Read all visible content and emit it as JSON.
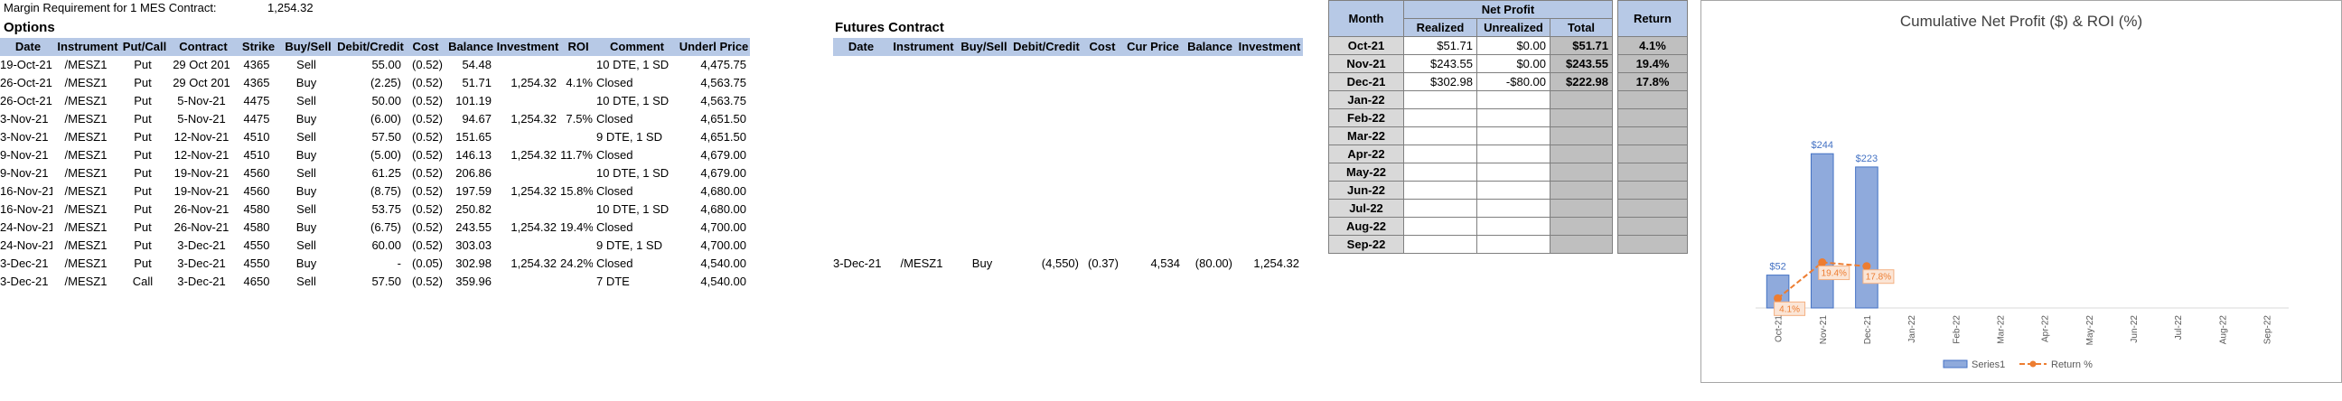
{
  "margin": {
    "label": "Margin Requirement for 1 MES Contract:",
    "value": "1,254.32"
  },
  "options": {
    "title": "Options",
    "headers": [
      "Date",
      "Instrument",
      "Put/Call",
      "Contract",
      "Strike",
      "Buy/Sell",
      "Debit/Credit",
      "Cost",
      "Balance",
      "Investment",
      "ROI",
      "Comment",
      "Underl Price"
    ],
    "rows": [
      [
        "19-Oct-21",
        "/MESZ1",
        "Put",
        "29 Oct 201",
        "4365",
        "Sell",
        "55.00",
        "(0.52)",
        "54.48",
        "",
        "",
        "10 DTE, 1 SD",
        "4,475.75"
      ],
      [
        "26-Oct-21",
        "/MESZ1",
        "Put",
        "29 Oct 201",
        "4365",
        "Buy",
        "(2.25)",
        "(0.52)",
        "51.71",
        "1,254.32",
        "4.1%",
        "Closed",
        "4,563.75"
      ],
      [
        "26-Oct-21",
        "/MESZ1",
        "Put",
        "5-Nov-21",
        "4475",
        "Sell",
        "50.00",
        "(0.52)",
        "101.19",
        "",
        "",
        "10 DTE, 1 SD",
        "4,563.75"
      ],
      [
        "3-Nov-21",
        "/MESZ1",
        "Put",
        "5-Nov-21",
        "4475",
        "Buy",
        "(6.00)",
        "(0.52)",
        "94.67",
        "1,254.32",
        "7.5%",
        "Closed",
        "4,651.50"
      ],
      [
        "3-Nov-21",
        "/MESZ1",
        "Put",
        "12-Nov-21",
        "4510",
        "Sell",
        "57.50",
        "(0.52)",
        "151.65",
        "",
        "",
        "9 DTE, 1 SD",
        "4,651.50"
      ],
      [
        "9-Nov-21",
        "/MESZ1",
        "Put",
        "12-Nov-21",
        "4510",
        "Buy",
        "(5.00)",
        "(0.52)",
        "146.13",
        "1,254.32",
        "11.7%",
        "Closed",
        "4,679.00"
      ],
      [
        "9-Nov-21",
        "/MESZ1",
        "Put",
        "19-Nov-21",
        "4560",
        "Sell",
        "61.25",
        "(0.52)",
        "206.86",
        "",
        "",
        "10 DTE, 1 SD",
        "4,679.00"
      ],
      [
        "16-Nov-21",
        "/MESZ1",
        "Put",
        "19-Nov-21",
        "4560",
        "Buy",
        "(8.75)",
        "(0.52)",
        "197.59",
        "1,254.32",
        "15.8%",
        "Closed",
        "4,680.00"
      ],
      [
        "16-Nov-21",
        "/MESZ1",
        "Put",
        "26-Nov-21",
        "4580",
        "Sell",
        "53.75",
        "(0.52)",
        "250.82",
        "",
        "",
        "10 DTE, 1 SD",
        "4,680.00"
      ],
      [
        "24-Nov-21",
        "/MESZ1",
        "Put",
        "26-Nov-21",
        "4580",
        "Buy",
        "(6.75)",
        "(0.52)",
        "243.55",
        "1,254.32",
        "19.4%",
        "Closed",
        "4,700.00"
      ],
      [
        "24-Nov-21",
        "/MESZ1",
        "Put",
        "3-Dec-21",
        "4550",
        "Sell",
        "60.00",
        "(0.52)",
        "303.03",
        "",
        "",
        "9 DTE, 1 SD",
        "4,700.00"
      ],
      [
        "3-Dec-21",
        "/MESZ1",
        "Put",
        "3-Dec-21",
        "4550",
        "Buy",
        "-",
        "(0.05)",
        "302.98",
        "1,254.32",
        "24.2%",
        "Closed",
        "4,540.00"
      ],
      [
        "3-Dec-21",
        "/MESZ1",
        "Call",
        "3-Dec-21",
        "4650",
        "Sell",
        "57.50",
        "(0.52)",
        "359.96",
        "",
        "",
        "7 DTE",
        "4,540.00"
      ]
    ]
  },
  "futures": {
    "title": "Futures Contract",
    "headers": [
      "Date",
      "Instrument",
      "Buy/Sell",
      "Debit/Credit",
      "Cost",
      "Cur Price",
      "Balance",
      "Investment"
    ],
    "rows": [
      [
        "3-Dec-21",
        "/MESZ1",
        "Buy",
        "(4,550)",
        "(0.37)",
        "4,534",
        "(80.00)",
        "1,254.32"
      ]
    ]
  },
  "summary": {
    "month_header": "Month",
    "net_profit_header": "Net Profit",
    "realized_header": "Realized",
    "unrealized_header": "Unrealized",
    "total_header": "Total",
    "return_header": "Return",
    "rows": [
      {
        "month": "Oct-21",
        "realized": "$51.71",
        "unrealized": "$0.00",
        "total": "$51.71",
        "ret": "4.1%"
      },
      {
        "month": "Nov-21",
        "realized": "$243.55",
        "unrealized": "$0.00",
        "total": "$243.55",
        "ret": "19.4%"
      },
      {
        "month": "Dec-21",
        "realized": "$302.98",
        "unrealized": "-$80.00",
        "total": "$222.98",
        "ret": "17.8%"
      },
      {
        "month": "Jan-22",
        "realized": "",
        "unrealized": "",
        "total": "",
        "ret": ""
      },
      {
        "month": "Feb-22",
        "realized": "",
        "unrealized": "",
        "total": "",
        "ret": ""
      },
      {
        "month": "Mar-22",
        "realized": "",
        "unrealized": "",
        "total": "",
        "ret": ""
      },
      {
        "month": "Apr-22",
        "realized": "",
        "unrealized": "",
        "total": "",
        "ret": ""
      },
      {
        "month": "May-22",
        "realized": "",
        "unrealized": "",
        "total": "",
        "ret": ""
      },
      {
        "month": "Jun-22",
        "realized": "",
        "unrealized": "",
        "total": "",
        "ret": ""
      },
      {
        "month": "Jul-22",
        "realized": "",
        "unrealized": "",
        "total": "",
        "ret": ""
      },
      {
        "month": "Aug-22",
        "realized": "",
        "unrealized": "",
        "total": "",
        "ret": ""
      },
      {
        "month": "Sep-22",
        "realized": "",
        "unrealized": "",
        "total": "",
        "ret": ""
      }
    ]
  },
  "colors": {
    "header_fill": "#b7c9e6",
    "bar": "#8faadc",
    "bar_stroke": "#4472c4",
    "line": "#ed7d31",
    "label_blue": "#4472c4"
  },
  "chart_data": {
    "type": "bar",
    "title": "Cumulative Net Profit ($) & ROI (%)",
    "categories": [
      "Oct-21",
      "Nov-21",
      "Dec-21",
      "Jan-22",
      "Feb-22",
      "Mar-22",
      "Apr-22",
      "May-22",
      "Jun-22",
      "Jul-22",
      "Aug-22",
      "Sep-22"
    ],
    "series": [
      {
        "name": "Series1",
        "type": "bar",
        "values": [
          52,
          244,
          223,
          null,
          null,
          null,
          null,
          null,
          null,
          null,
          null,
          null
        ],
        "labels": [
          "$52",
          "$244",
          "$223"
        ]
      },
      {
        "name": "Return %",
        "type": "line",
        "values": [
          4.1,
          19.4,
          17.8,
          null,
          null,
          null,
          null,
          null,
          null,
          null,
          null,
          null
        ],
        "labels": [
          "4.1%",
          "19.4%",
          "17.8%"
        ]
      }
    ],
    "ylim": [
      0,
      400
    ],
    "legend": "bottom"
  }
}
